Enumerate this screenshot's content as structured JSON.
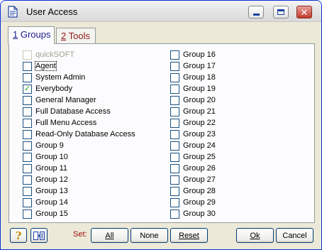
{
  "window": {
    "title": "User Access"
  },
  "tabs": [
    {
      "mnemonic": "1",
      "label": "Groups"
    },
    {
      "mnemonic": "2",
      "label": "Tools"
    }
  ],
  "groups_left": [
    {
      "label": "quickSOFT",
      "checked": false,
      "disabled": true
    },
    {
      "label": "Agent",
      "checked": false,
      "focused": true
    },
    {
      "label": "System Admin",
      "checked": false
    },
    {
      "label": "Everybody",
      "checked": true
    },
    {
      "label": "General Manager",
      "checked": false
    },
    {
      "label": "Full Database Access",
      "checked": false
    },
    {
      "label": "Full Menu Access",
      "checked": false
    },
    {
      "label": "Read-Only Database Access",
      "checked": false
    },
    {
      "label": "Group 9",
      "checked": false
    },
    {
      "label": "Group 10",
      "checked": false
    },
    {
      "label": "Group 11",
      "checked": false
    },
    {
      "label": "Group 12",
      "checked": false
    },
    {
      "label": "Group 13",
      "checked": false
    },
    {
      "label": "Group 14",
      "checked": false
    },
    {
      "label": "Group 15",
      "checked": false
    }
  ],
  "groups_right": [
    {
      "label": "Group 16",
      "checked": false
    },
    {
      "label": "Group 17",
      "checked": false
    },
    {
      "label": "Group 18",
      "checked": false
    },
    {
      "label": "Group 19",
      "checked": false
    },
    {
      "label": "Group 20",
      "checked": false
    },
    {
      "label": "Group 21",
      "checked": false
    },
    {
      "label": "Group 22",
      "checked": false
    },
    {
      "label": "Group 23",
      "checked": false
    },
    {
      "label": "Group 24",
      "checked": false
    },
    {
      "label": "Group 25",
      "checked": false
    },
    {
      "label": "Group 26",
      "checked": false
    },
    {
      "label": "Group 27",
      "checked": false
    },
    {
      "label": "Group 28",
      "checked": false
    },
    {
      "label": "Group 29",
      "checked": false
    },
    {
      "label": "Group 30",
      "checked": false
    }
  ],
  "footer": {
    "set_label": "Set:",
    "all_label": "All",
    "none_label": "None",
    "reset_label": "Reset",
    "ok_label": "Ok",
    "cancel_label": "Cancel",
    "help_icon": "question-mark-icon",
    "layout_icon": "panel-swap-icon"
  },
  "colors": {
    "accent": "#0831d9",
    "checked": "#21a121",
    "set_label": "#a01010"
  }
}
